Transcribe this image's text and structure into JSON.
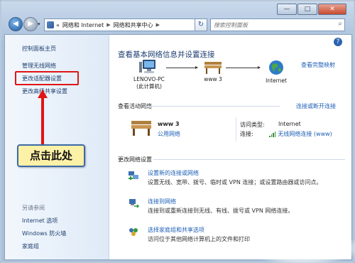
{
  "window": {
    "buttons": {
      "min": "—",
      "max": "□",
      "close": "✕"
    }
  },
  "address": {
    "chevrons": "«",
    "crumbs": [
      "网络和 Internet",
      "网络和共享中心"
    ],
    "search_placeholder": "搜索控制面板"
  },
  "sidebar": {
    "home": "控制面板主页",
    "links": [
      "管理无线网络",
      "更改适配器设置",
      "更改高级共享设置"
    ],
    "see_also_title": "另请参阅",
    "see_also": [
      "Internet 选项",
      "Windows 防火墙",
      "家庭组"
    ]
  },
  "main": {
    "title": "查看基本网络信息并设置连接",
    "full_map_link": "查看完整映射",
    "map": {
      "pc_name": "LENOVO-PC",
      "pc_sub": "(此计算机)",
      "network": "www  3",
      "internet": "Internet"
    },
    "active_title": "查看活动网络",
    "connect_link": "连接或断开连接",
    "active": {
      "name": "www  3",
      "type": "公用网络",
      "access_label": "访问类型:",
      "access_value": "Internet",
      "conn_label": "连接:",
      "conn_value": "无线网络连接 (www)"
    },
    "settings_title": "更改网络设置",
    "tasks": [
      {
        "icon": "new-connection-icon",
        "link": "设置新的连接或网络",
        "desc": "设置无线、宽带、拨号、临时或 VPN 连接；或设置路由器或访问点。"
      },
      {
        "icon": "connect-network-icon",
        "link": "连接到网络",
        "desc": "连接到或重新连接到无线、有线、拨号或 VPN 网络连接。"
      },
      {
        "icon": "homegroup-icon",
        "link": "选择家庭组和共享选项",
        "desc": "访问位于其他网络计算机上的文件和打印"
      }
    ]
  },
  "annotation": {
    "callout_text": "点击此处",
    "highlight_color": "#e01515"
  }
}
